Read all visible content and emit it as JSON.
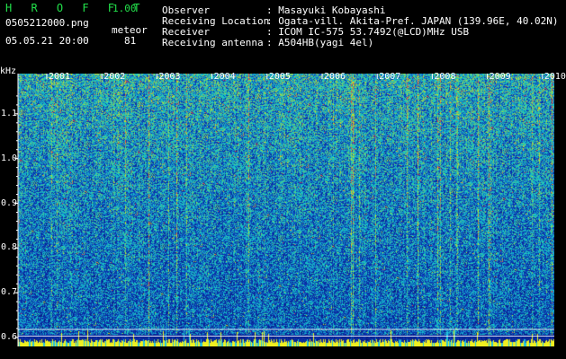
{
  "header": {
    "app_title": "H R O F F T",
    "app_version": "1.00",
    "filename": "0505212000.png",
    "mode": "meteor",
    "timestamp": "05.05.21 20:00",
    "count": "81"
  },
  "info": [
    {
      "label": "Observer",
      "value": ": Masayuki Kobayashi"
    },
    {
      "label": "Receiving Location",
      "value": ": Ogata-vill. Akita-Pref. JAPAN (139.96E, 40.02N)"
    },
    {
      "label": "Receiver",
      "value": ": ICOM IC-575 53.7492(@LCD)MHz USB"
    },
    {
      "label": "Receiving antenna",
      "value": ": A504HB(yagi 4el)"
    }
  ],
  "colors": {
    "background": "#000000",
    "title_green": "#22e04a",
    "axis_white": "#ffffff",
    "spectrum_low": "#0a1a8a",
    "spectrum_mid": "#1ec8e0",
    "spectrum_high": "#f0e020",
    "baseline_yellow": "#f0f020"
  },
  "chart_data": {
    "type": "heatmap",
    "ylabel": "kHz",
    "x_ticks": [
      "2001",
      "2002",
      "2003",
      "2004",
      "2005",
      "2006",
      "2007",
      "2008",
      "2009",
      "2010"
    ],
    "y_ticks": [
      "1.1",
      "1.0",
      "0.9",
      "0.8",
      "0.7",
      "0.6"
    ],
    "y_tick_values": [
      1.1,
      1.0,
      0.9,
      0.8,
      0.7,
      0.6
    ],
    "ylim": [
      0.58,
      1.19
    ],
    "grid": false
  }
}
